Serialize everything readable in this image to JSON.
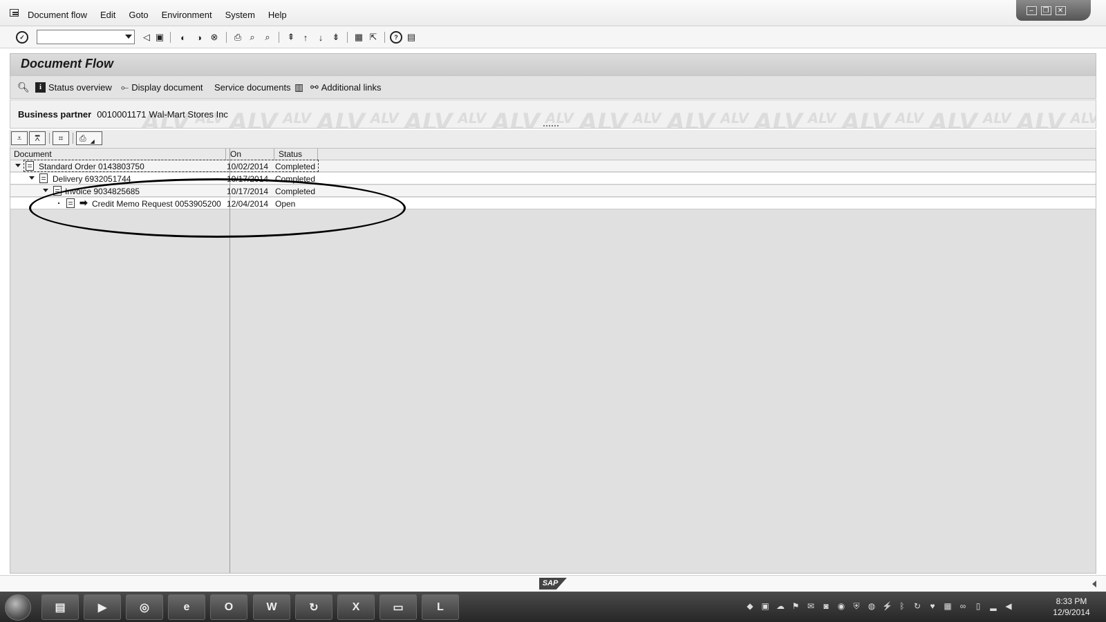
{
  "menu": {
    "items": [
      "Document flow",
      "Edit",
      "Goto",
      "Environment",
      "System",
      "Help"
    ]
  },
  "window_controls": {
    "minimize": "–",
    "restore": "❐",
    "close": "✕"
  },
  "command_field": {
    "value": "",
    "placeholder": ""
  },
  "title": "Document Flow",
  "app_toolbar": {
    "status_overview": "Status overview",
    "display_document": "Display document",
    "service_documents": "Service documents",
    "additional_links": "Additional links"
  },
  "header": {
    "bp_label": "Business partner",
    "bp_number": "0010001171",
    "bp_name": "Wal-Mart Stores Inc",
    "watermark_big": "ALV",
    "watermark_small": "ALV"
  },
  "grid": {
    "columns": [
      "Document",
      "On",
      "Status"
    ],
    "rows": [
      {
        "document": "Standard Order 0143803750",
        "on": "10/02/2014",
        "status": "Completed",
        "level": 0,
        "expander": "expanded"
      },
      {
        "document": "Delivery 6932051744",
        "on": "10/17/2014",
        "status": "Completed",
        "level": 1,
        "expander": "expanded"
      },
      {
        "document": "Invoice 9034825685",
        "on": "10/17/2014",
        "status": "Completed",
        "level": 2,
        "expander": "expanded"
      },
      {
        "document": "Credit Memo Request 0053905200",
        "on": "12/04/2014",
        "status": "Open",
        "level": 3,
        "expander": "leaf",
        "current": true
      }
    ]
  },
  "status_bar": {
    "logo": "SAP"
  },
  "taskbar": {
    "apps": [
      "file-explorer",
      "media-player",
      "chrome",
      "internet-explorer",
      "outlook",
      "word",
      "sap-logon",
      "excel",
      "desktop",
      "lync"
    ],
    "app_glyphs": [
      "▤",
      "▶",
      "◎",
      "e",
      "O",
      "W",
      "↻",
      "X",
      "▭",
      "L"
    ],
    "clock_time": "8:33 PM",
    "clock_date": "12/9/2014"
  }
}
